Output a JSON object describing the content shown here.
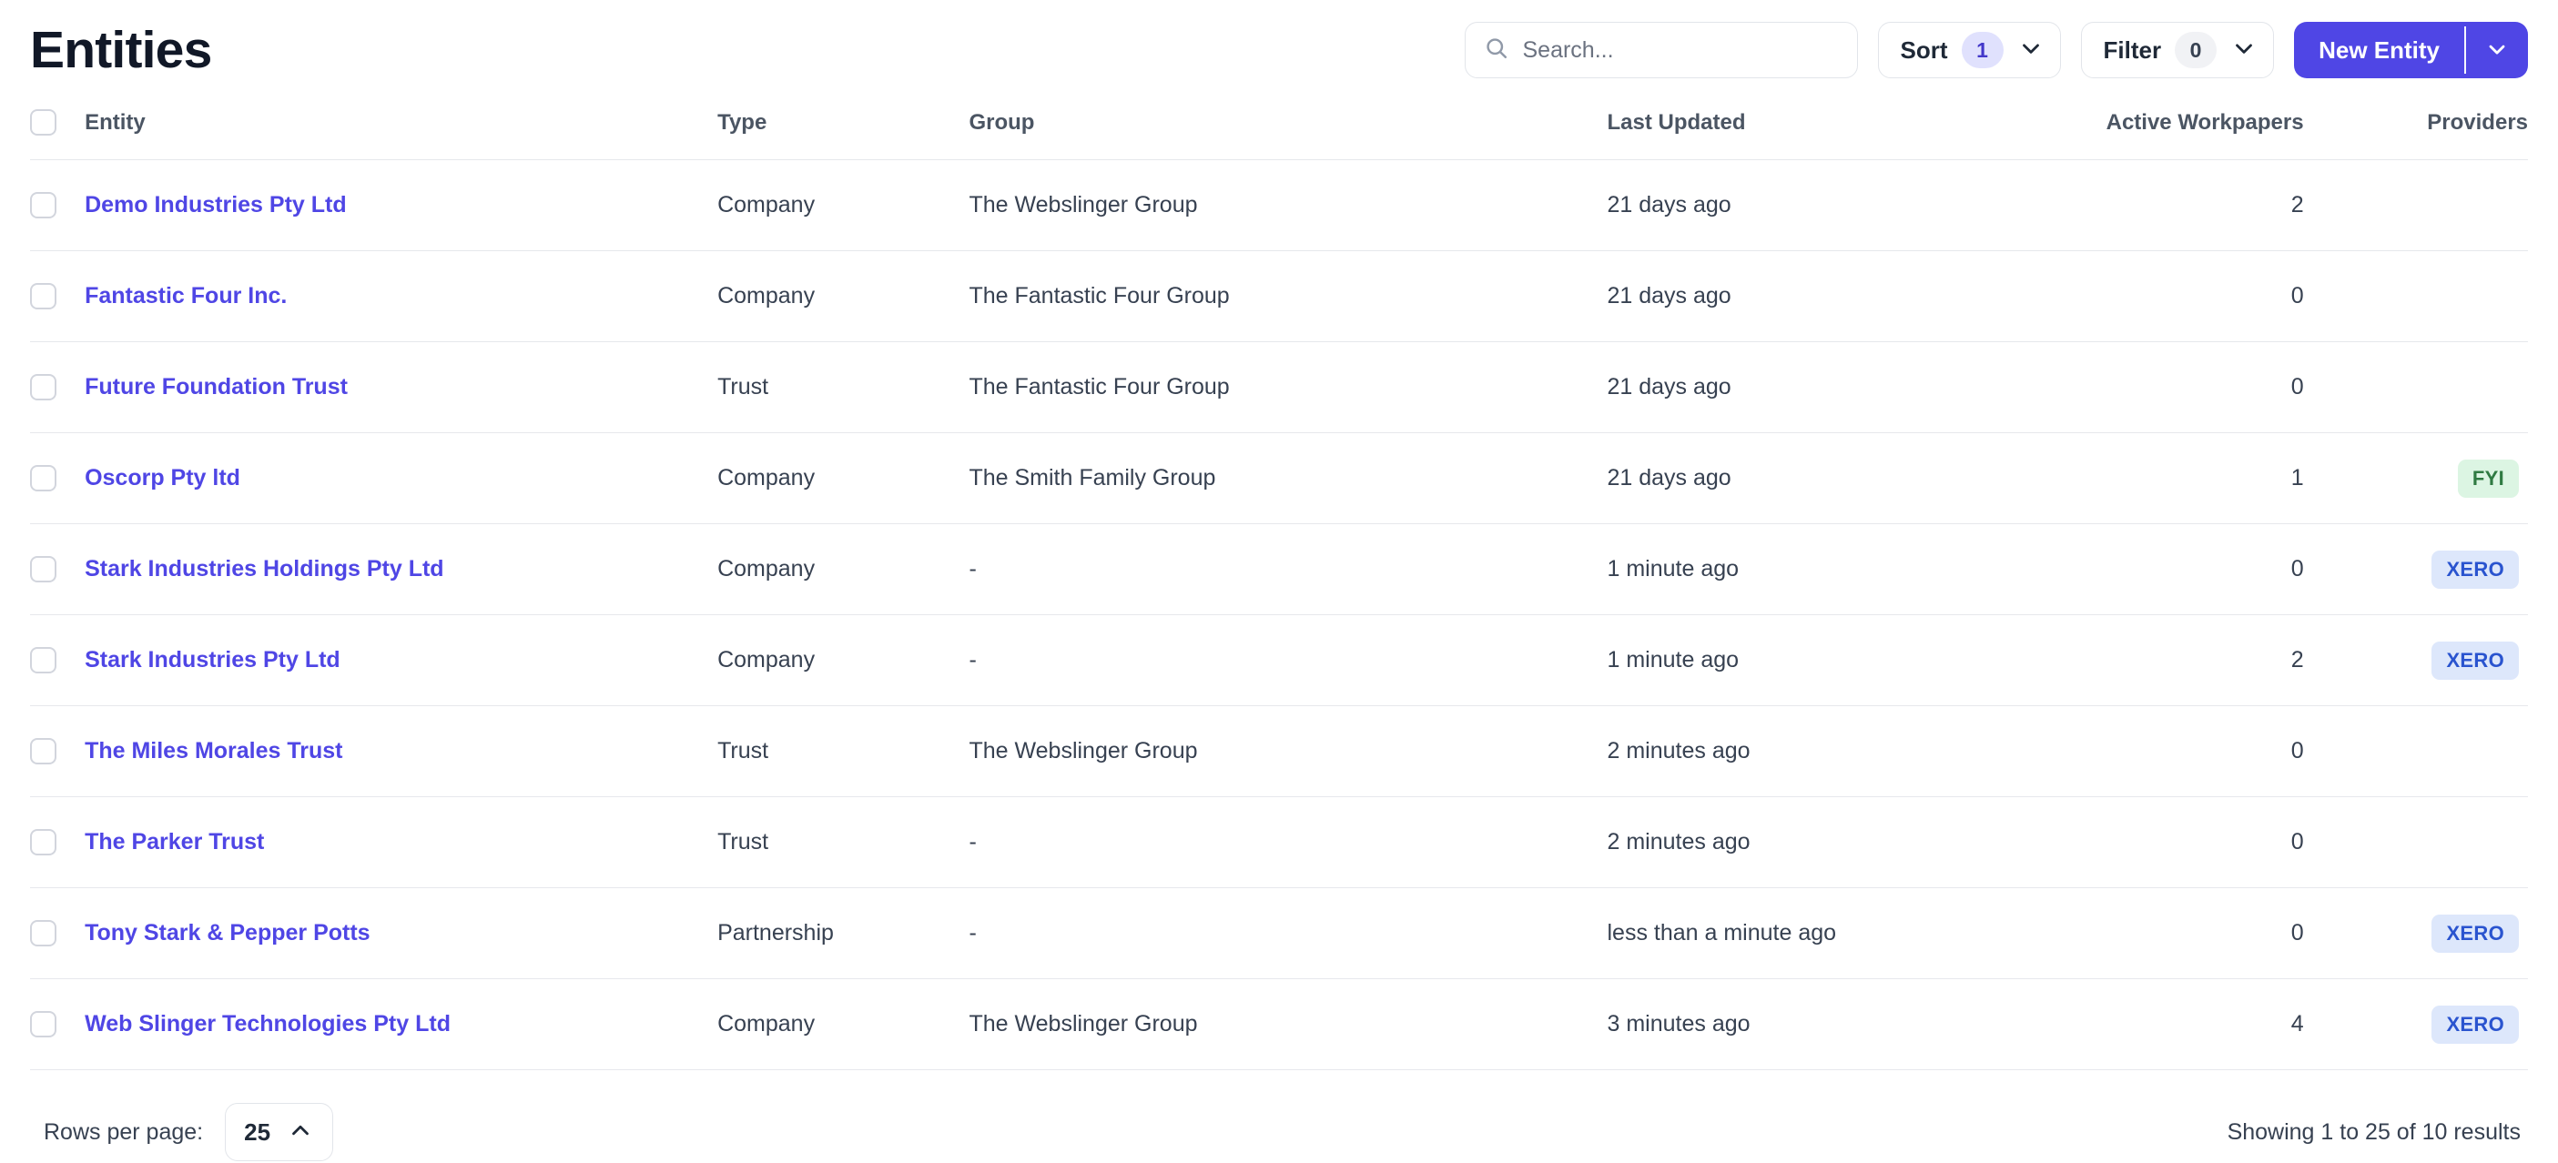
{
  "header": {
    "title": "Entities",
    "search": {
      "placeholder": "Search...",
      "value": "",
      "icon": "search-icon"
    },
    "sort": {
      "label": "Sort",
      "count": "1",
      "icon": "chevron-down-icon"
    },
    "filter": {
      "label": "Filter",
      "count": "0",
      "icon": "chevron-down-icon"
    },
    "new_entity": {
      "label": "New Entity",
      "caret_icon": "chevron-down-icon"
    }
  },
  "table": {
    "columns": [
      {
        "key": "check",
        "label": ""
      },
      {
        "key": "entity",
        "label": "Entity"
      },
      {
        "key": "type",
        "label": "Type"
      },
      {
        "key": "group",
        "label": "Group"
      },
      {
        "key": "date",
        "label": "Last Updated"
      },
      {
        "key": "wp",
        "label": "Active Workpapers"
      },
      {
        "key": "prov",
        "label": "Providers"
      }
    ],
    "rows": [
      {
        "entity": "Demo Industries Pty Ltd",
        "type": "Company",
        "group": "The Webslinger Group",
        "last_updated": "21 days ago",
        "active_workpapers": "2",
        "provider": ""
      },
      {
        "entity": "Fantastic Four Inc.",
        "type": "Company",
        "group": "The Fantastic Four Group",
        "last_updated": "21 days ago",
        "active_workpapers": "0",
        "provider": ""
      },
      {
        "entity": "Future Foundation Trust",
        "type": "Trust",
        "group": "The Fantastic Four Group",
        "last_updated": "21 days ago",
        "active_workpapers": "0",
        "provider": ""
      },
      {
        "entity": "Oscorp Pty ltd",
        "type": "Company",
        "group": "The Smith Family Group",
        "last_updated": "21 days ago",
        "active_workpapers": "1",
        "provider": "FYI"
      },
      {
        "entity": "Stark Industries Holdings Pty Ltd",
        "type": "Company",
        "group": "-",
        "last_updated": "1 minute ago",
        "active_workpapers": "0",
        "provider": "XERO"
      },
      {
        "entity": "Stark Industries Pty Ltd",
        "type": "Company",
        "group": "-",
        "last_updated": "1 minute ago",
        "active_workpapers": "2",
        "provider": "XERO"
      },
      {
        "entity": "The Miles Morales Trust",
        "type": "Trust",
        "group": "The Webslinger Group",
        "last_updated": "2 minutes ago",
        "active_workpapers": "0",
        "provider": ""
      },
      {
        "entity": "The Parker Trust",
        "type": "Trust",
        "group": "-",
        "last_updated": "2 minutes ago",
        "active_workpapers": "0",
        "provider": ""
      },
      {
        "entity": "Tony Stark & Pepper Potts",
        "type": "Partnership",
        "group": "-",
        "last_updated": "less than a minute ago",
        "active_workpapers": "0",
        "provider": "XERO"
      },
      {
        "entity": "Web Slinger Technologies Pty Ltd",
        "type": "Company",
        "group": "The Webslinger Group",
        "last_updated": "3 minutes ago",
        "active_workpapers": "4",
        "provider": "XERO"
      }
    ]
  },
  "footer": {
    "rows_per_page_label": "Rows per page:",
    "rows_per_page_value": "25",
    "rows_per_page_icon": "chevron-up-icon",
    "results_text": "Showing 1 to 25 of 10 results"
  },
  "colors": {
    "accent": "#4f46e5",
    "link": "#4f46e5",
    "xero_bg": "#dde7fb",
    "xero_fg": "#2a54cf",
    "fyi_bg": "#dcf5e3",
    "fyi_fg": "#2f7a42"
  }
}
